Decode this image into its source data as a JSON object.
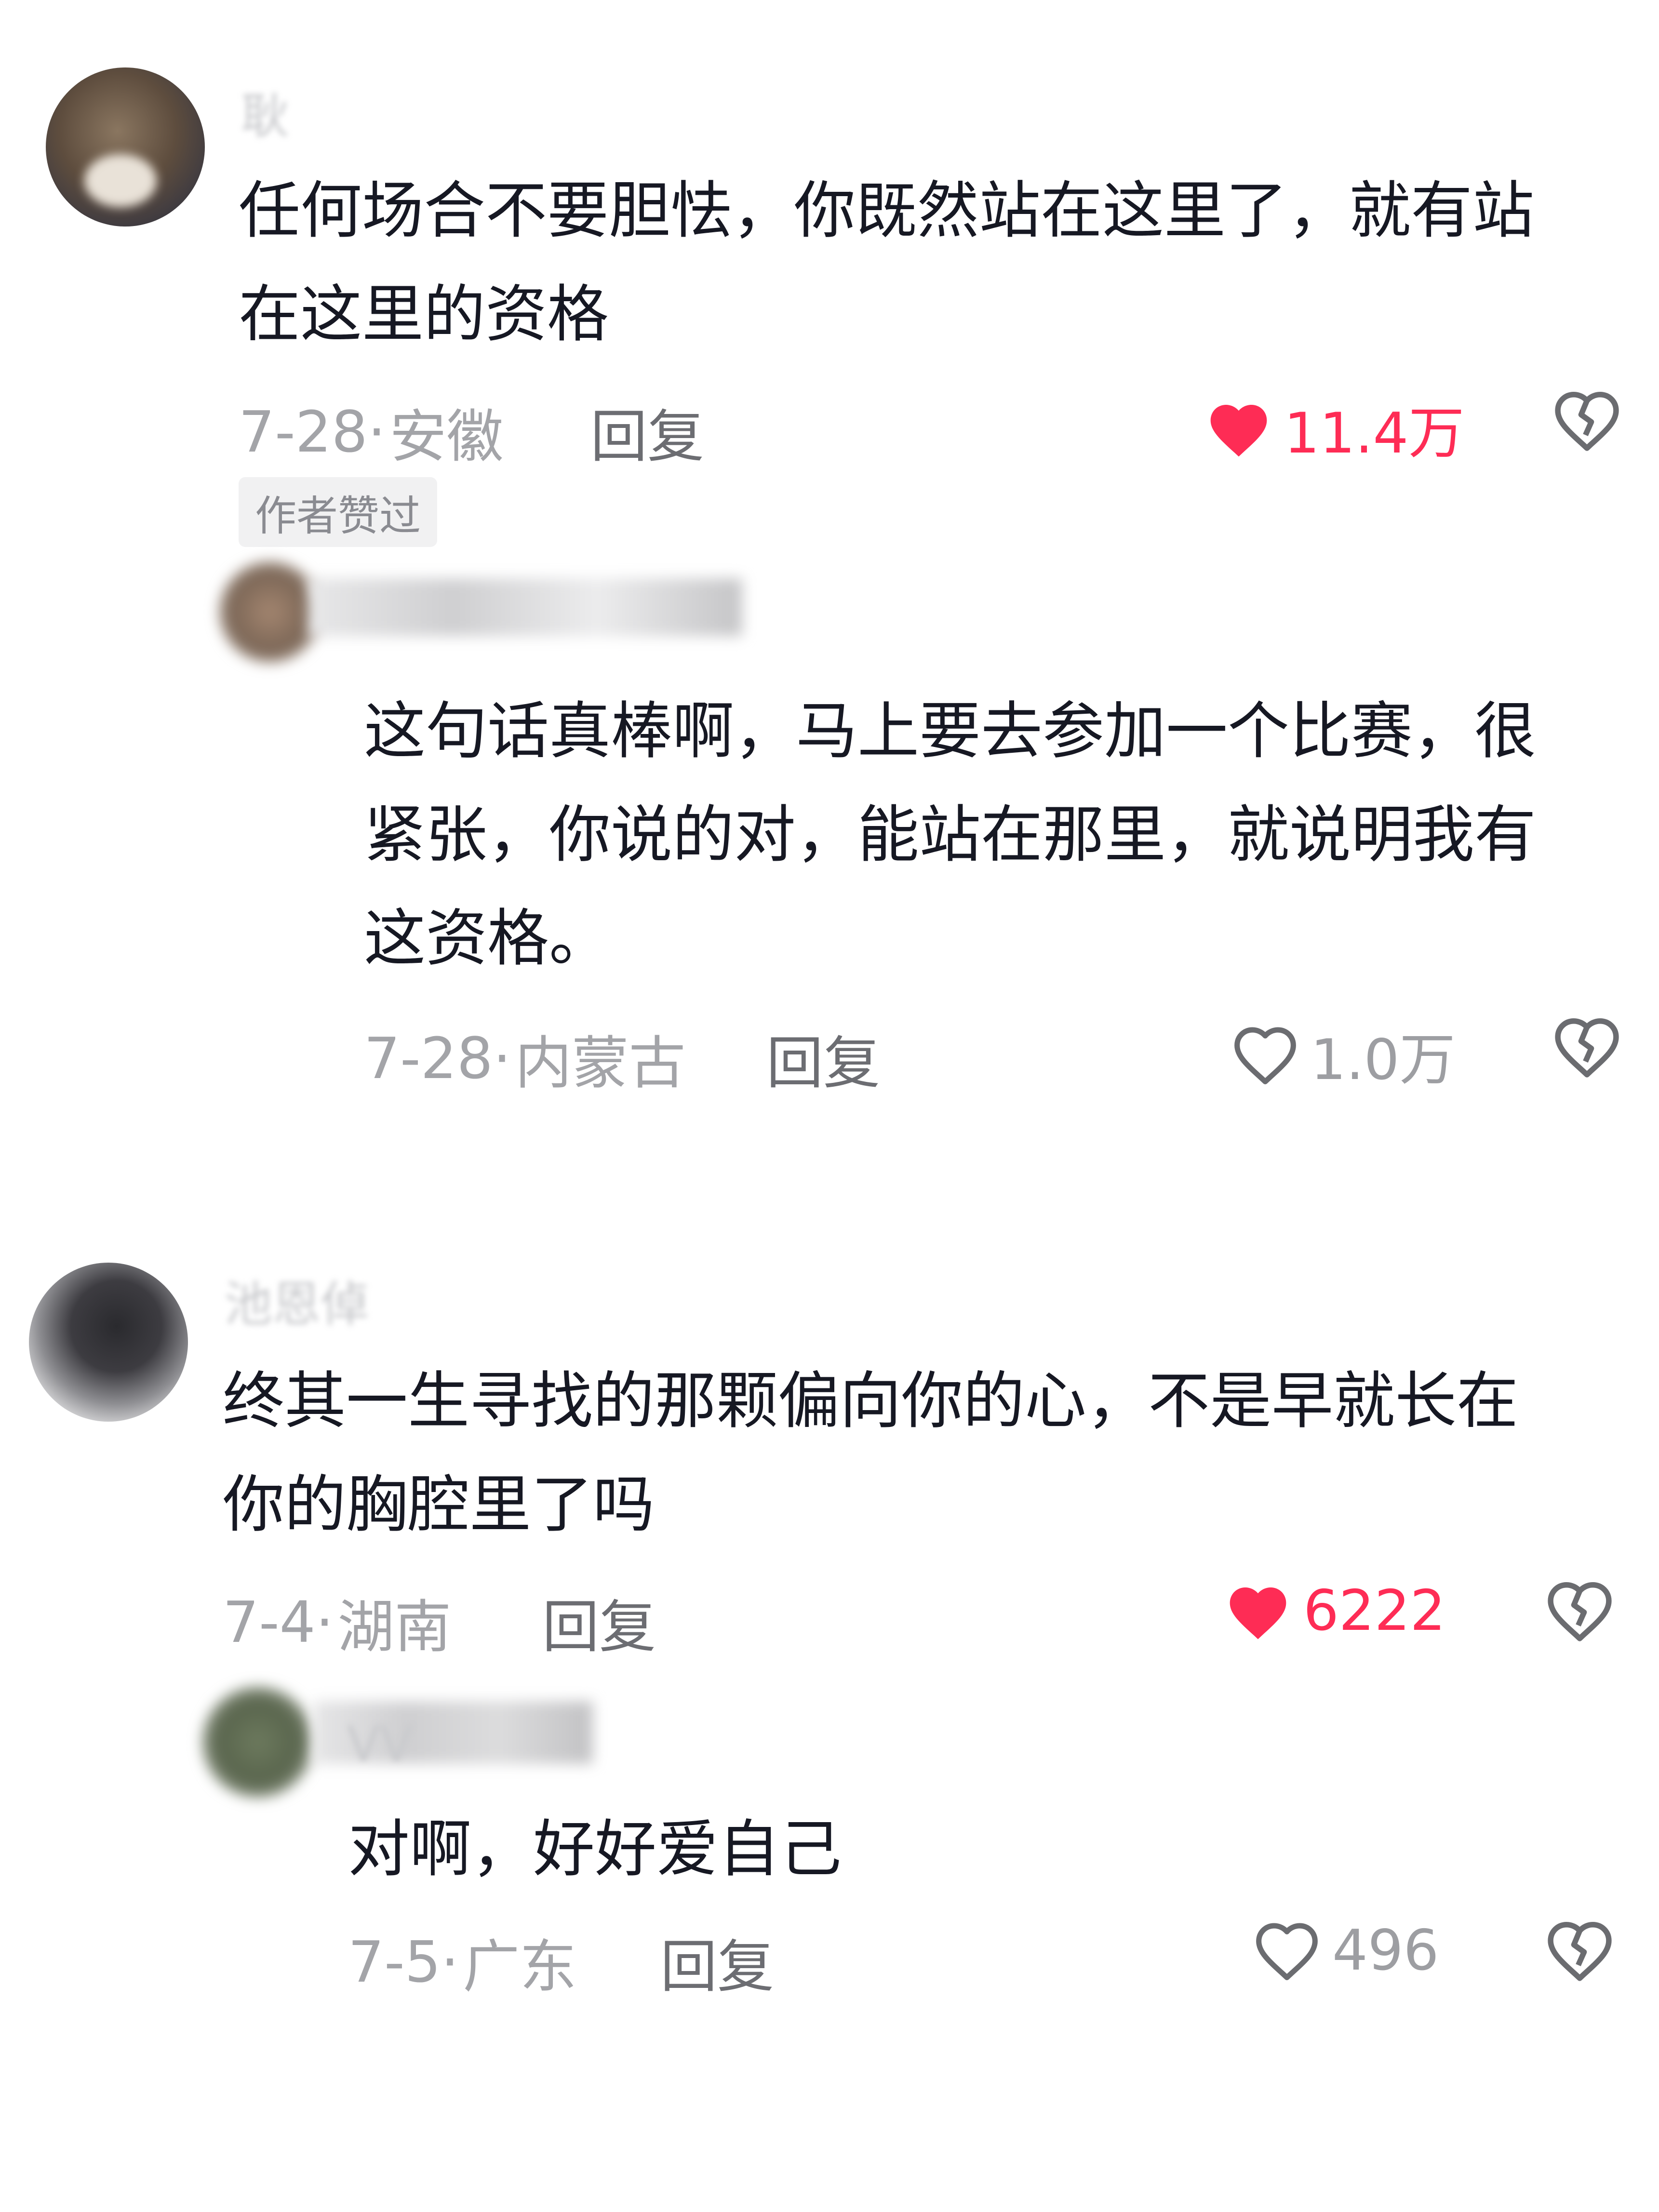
{
  "comments": [
    {
      "author": "耿",
      "text_lines": [
        "任何场合不要胆怯，你既然站在这里了，就有站",
        "在这里的资格"
      ],
      "date": "7-28",
      "location": "安徽",
      "reply_label": "回复",
      "likes": "11.4万",
      "liked": true,
      "tag": "作者赞过",
      "replies": [
        {
          "author": "",
          "text_lines": [
            "这句话真棒啊，马上要去参加一个比赛，很",
            "紧张，你说的对，能站在那里，就说明我有",
            "这资格。"
          ],
          "date": "7-28",
          "location": "内蒙古",
          "reply_label": "回复",
          "likes": "1.0万",
          "liked": false
        }
      ]
    },
    {
      "author": "池恩倬",
      "text_lines": [
        "终其一生寻找的那颗偏向你的心，不是早就长在",
        "你的胸腔里了吗"
      ],
      "date": "7-4",
      "location": "湖南",
      "reply_label": "回复",
      "likes": "6222",
      "liked": true,
      "replies": [
        {
          "author": "VV",
          "text_lines": [
            "对啊，好好爱自己"
          ],
          "date": "7-5",
          "location": "广东",
          "reply_label": "回复",
          "likes": "496",
          "liked": false
        }
      ]
    }
  ],
  "colors": {
    "liked": "#fe2c55",
    "muted": "#a3a4a8",
    "text": "#161823"
  },
  "icons": {
    "like": "heart-icon",
    "dislike": "broken-heart-icon"
  }
}
